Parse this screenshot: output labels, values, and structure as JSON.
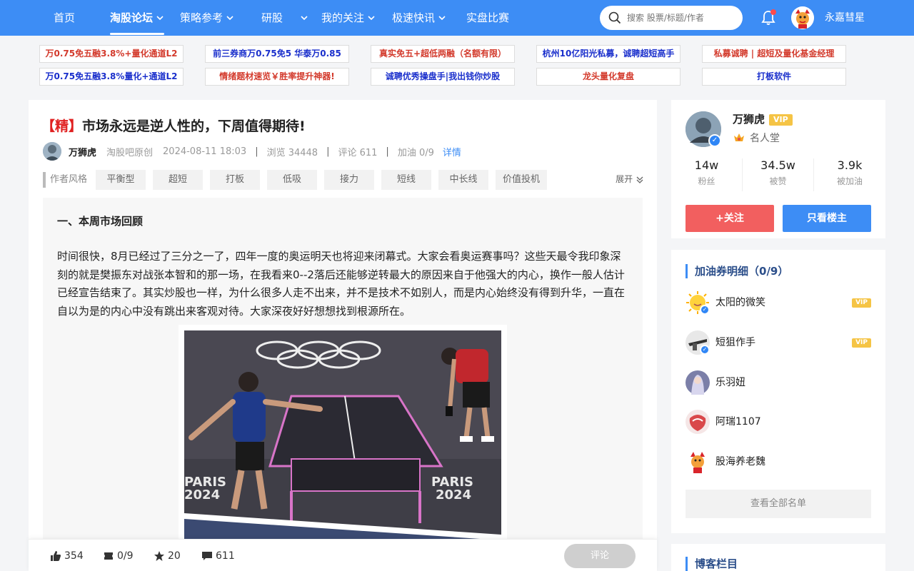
{
  "nav": {
    "items": [
      {
        "label": "首页",
        "dropdown": false
      },
      {
        "label": "淘股论坛",
        "dropdown": true,
        "active": true
      },
      {
        "label": "策略参考",
        "dropdown": true
      },
      {
        "label": "研股",
        "dropdown": true
      },
      {
        "label": "我的关注",
        "dropdown": true
      },
      {
        "label": "极速快讯",
        "dropdown": true
      },
      {
        "label": "实盘比赛",
        "dropdown": false
      }
    ],
    "search_placeholder": "搜索 股票/标题/作者",
    "user_name": "永嘉彗星",
    "accent": "#3d8df5"
  },
  "ads": [
    {
      "text": "万0.75免五融3.8%+量化通道L2",
      "color": "#d33a2c"
    },
    {
      "text": "前三券商万0.75免5 华泰万0.85",
      "color": "#1a2fcc"
    },
    {
      "text": "真实免五+超低两融（名额有限）",
      "color": "#d33a2c"
    },
    {
      "text": "杭州10亿阳光私募，诚聘超短高手",
      "color": "#1a2fcc"
    },
    {
      "text": "私募诚聘 | 超短及量化基金经理",
      "color": "#d33a2c"
    },
    {
      "text": "万0.75免五融3.8%量化+通道L2",
      "color": "#1a2fcc"
    },
    {
      "text": "情绪题材速览￥胜率提升神器!",
      "color": "#d33a2c"
    },
    {
      "text": "诚聘优秀操盘手|我出钱你炒股",
      "color": "#1a2fcc"
    },
    {
      "text": "龙头量化复盘",
      "color": "#d33a2c"
    },
    {
      "text": "打板软件",
      "color": "#1a2fcc"
    }
  ],
  "post": {
    "tag": "【精】",
    "title": "市场永远是逆人性的，下周值得期待!",
    "author": "万狮虎",
    "source": "淘股吧原创",
    "datetime": "2024-08-11 18:03",
    "views": "浏览 34448",
    "comments": "评论 611",
    "boost": "加油 0/9",
    "detail_link": "详情",
    "style_label": "作者风格",
    "styles": [
      "平衡型",
      "超短",
      "打板",
      "低吸",
      "接力",
      "短线",
      "中长线",
      "价值投机"
    ],
    "expand": "展开",
    "section_title": "一、本周市场回顾",
    "paragraph": "时间很快，8月已经过了三分之一了，四年一度的奥运明天也将迎来闭幕式。大家会看奥运赛事吗？这些天最令我印象深刻的就是樊振东对战张本智和的那一场，在我看来0--2落后还能够逆转最大的原因来自于他强大的内心，换作一般人估计已经宣告结束了。其实炒股也一样，为什么很多人走不出来，并不是技术不如别人，而是内心始终没有得到升华，一直在自以为是的内心中没有跳出来客观对待。大家深夜好好想想找到根源所在。",
    "image_texts": [
      "PARIS",
      "2024"
    ]
  },
  "bottom_bar": {
    "likes": "354",
    "boost": "0/9",
    "stars": "20",
    "comments": "611",
    "comment_button": "评论"
  },
  "author_card": {
    "name": "万狮虎",
    "vip": "VIP",
    "honor": "名人堂",
    "stats": [
      {
        "value": "14w",
        "label": "粉丝"
      },
      {
        "value": "34.5w",
        "label": "被赞"
      },
      {
        "value": "3.9k",
        "label": "被加油"
      }
    ],
    "follow_button": "+关注",
    "owner_only_button": "只看楼主"
  },
  "boost_list": {
    "title": "加油券明细（0/9）",
    "users": [
      {
        "name": "太阳的微笑",
        "vip": "VIP",
        "verified": true
      },
      {
        "name": "短狙作手",
        "vip": "VIP",
        "verified": true
      },
      {
        "name": "乐羽妞",
        "vip": "",
        "verified": false
      },
      {
        "name": "阿瑞1107",
        "vip": "",
        "verified": false
      },
      {
        "name": "股海养老魏",
        "vip": "",
        "verified": false
      }
    ],
    "view_all": "查看全部名单"
  },
  "blog_card": {
    "title": "博客栏目"
  }
}
